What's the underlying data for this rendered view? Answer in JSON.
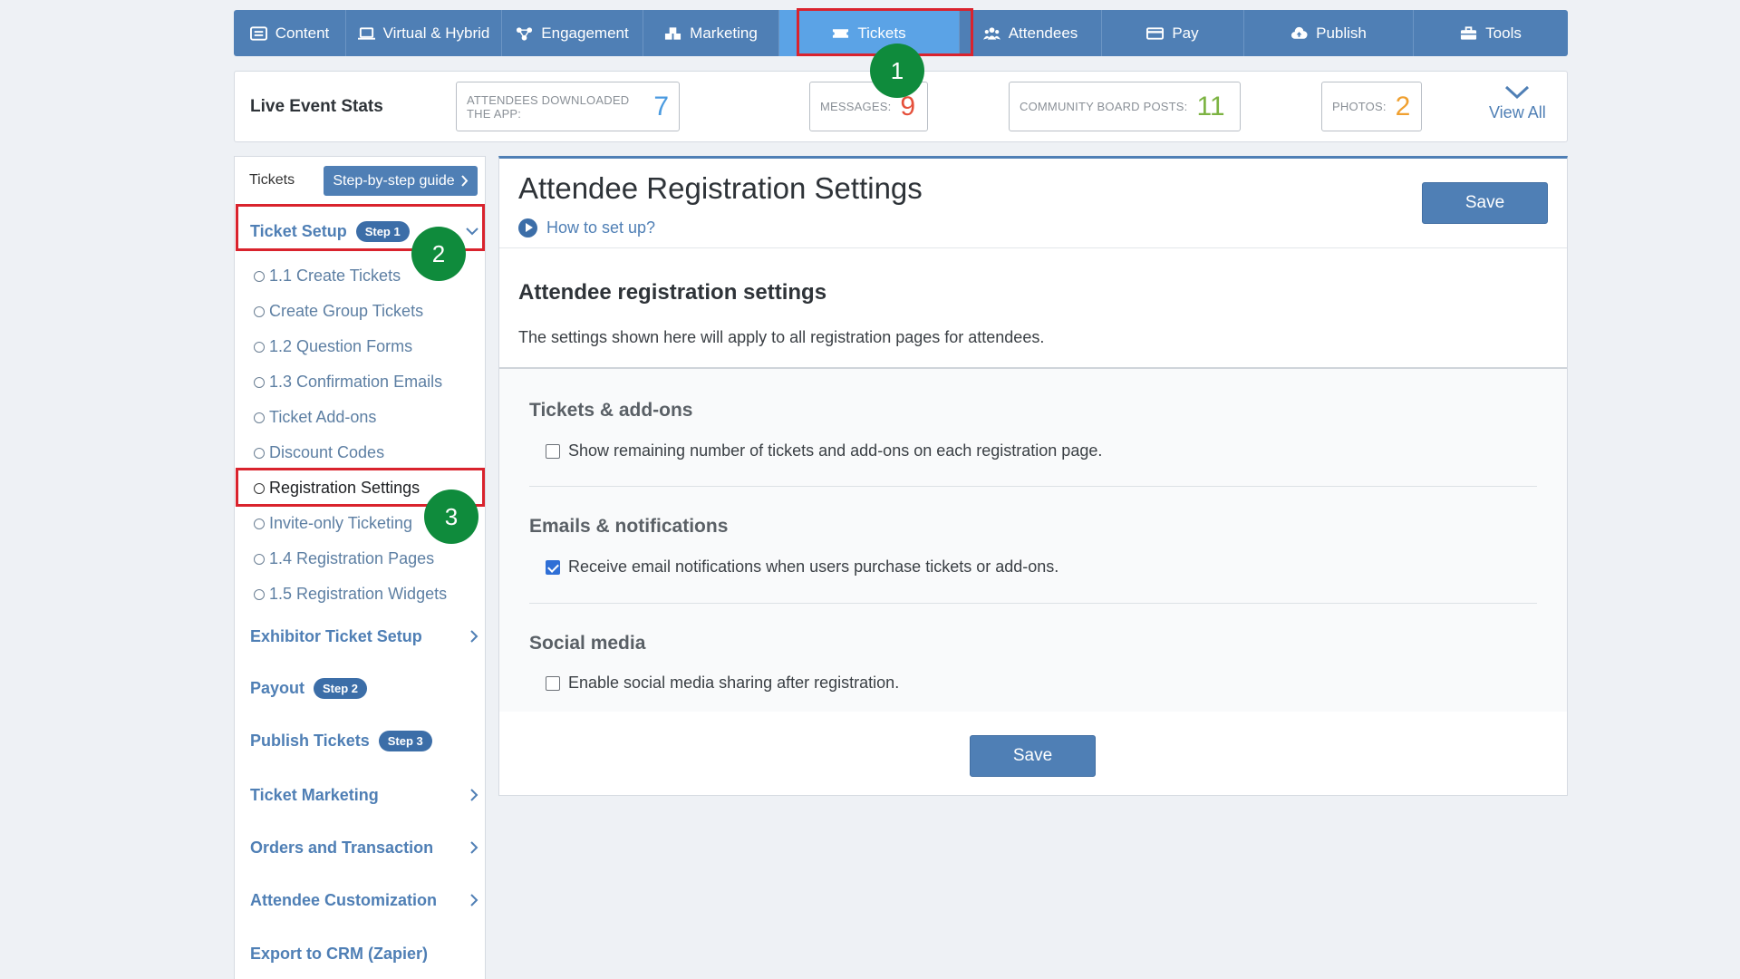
{
  "nav": {
    "items": [
      {
        "label": "Content",
        "icon": "document-icon"
      },
      {
        "label": "Virtual & Hybrid",
        "icon": "laptop-icon"
      },
      {
        "label": "Engagement",
        "icon": "network-icon"
      },
      {
        "label": "Marketing",
        "icon": "cubes-icon"
      },
      {
        "label": "Tickets",
        "icon": "ticket-icon",
        "active": true
      },
      {
        "label": "Attendees",
        "icon": "users-icon"
      },
      {
        "label": "Pay",
        "icon": "credit-card-icon"
      },
      {
        "label": "Publish",
        "icon": "cloud-upload-icon"
      },
      {
        "label": "Tools",
        "icon": "toolbox-icon"
      }
    ]
  },
  "stats": {
    "title": "Live Event Stats",
    "items": [
      {
        "label": "ATTENDEES DOWNLOADED THE APP:",
        "value": "7",
        "color": "#4b9be0"
      },
      {
        "label": "MESSAGES:",
        "value": "9",
        "color": "#e5503b"
      },
      {
        "label": "COMMUNITY BOARD POSTS:",
        "value": "11",
        "color": "#7cb342"
      },
      {
        "label": "PHOTOS:",
        "value": "2",
        "color": "#f0a030"
      }
    ],
    "view_all": "View All"
  },
  "sidebar": {
    "header_label": "Tickets",
    "guide_button": "Step-by-step guide",
    "ticket_setup": {
      "label": "Ticket Setup",
      "badge": "Step 1"
    },
    "sub_items": [
      "1.1 Create Tickets",
      "Create Group Tickets",
      "1.2 Question Forms",
      "1.3 Confirmation Emails",
      "Ticket Add-ons",
      "Discount Codes",
      "Registration Settings",
      "Invite-only Ticketing",
      "1.4 Registration Pages",
      "1.5 Registration Widgets"
    ],
    "exhibitor": "Exhibitor Ticket Setup",
    "payout": {
      "label": "Payout",
      "badge": "Step 2"
    },
    "publish": {
      "label": "Publish Tickets",
      "badge": "Step 3"
    },
    "ticket_marketing": "Ticket Marketing",
    "orders": "Orders and Transaction",
    "attendee_custom": "Attendee Customization",
    "export_crm": "Export to CRM (Zapier)"
  },
  "badges": [
    "1",
    "2",
    "3"
  ],
  "main": {
    "title": "Attendee Registration Settings",
    "howto": "How to set up?",
    "save": "Save",
    "section_heading": "Attendee registration settings",
    "section_desc": "The settings shown here will apply to all registration pages for attendees.",
    "groups": [
      {
        "title": "Tickets & add-ons",
        "option": "Show remaining number of tickets and add-ons on each registration page.",
        "checked": false
      },
      {
        "title": "Emails & notifications",
        "option": "Receive email notifications when users purchase tickets or add-ons.",
        "checked": true
      },
      {
        "title": "Social media",
        "option": "Enable social media sharing after registration.",
        "checked": false
      }
    ],
    "save_bottom": "Save"
  }
}
